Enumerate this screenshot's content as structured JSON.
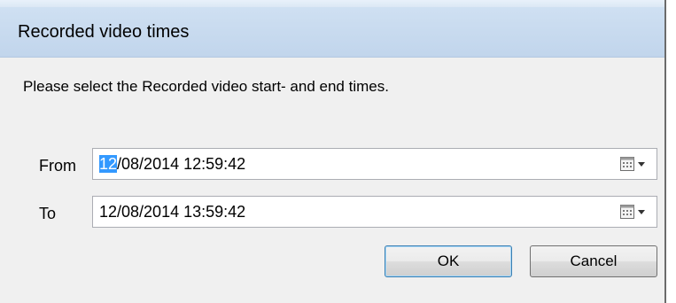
{
  "window": {
    "title": "Recorded video times"
  },
  "dialog": {
    "instructions": "Please select the Recorded video start- and end times.",
    "from": {
      "label": "From",
      "value_selected": "12",
      "value_rest": "/08/2014 12:59:42",
      "icon": "calendar-dropdown-icon"
    },
    "to": {
      "label": "To",
      "value": "12/08/2014 13:59:42",
      "icon": "calendar-dropdown-icon"
    },
    "buttons": {
      "ok": "OK",
      "cancel": "Cancel"
    }
  },
  "colors": {
    "titlebar": "#c8dbef",
    "selection": "#3399ff",
    "background": "#f0f0f0"
  }
}
